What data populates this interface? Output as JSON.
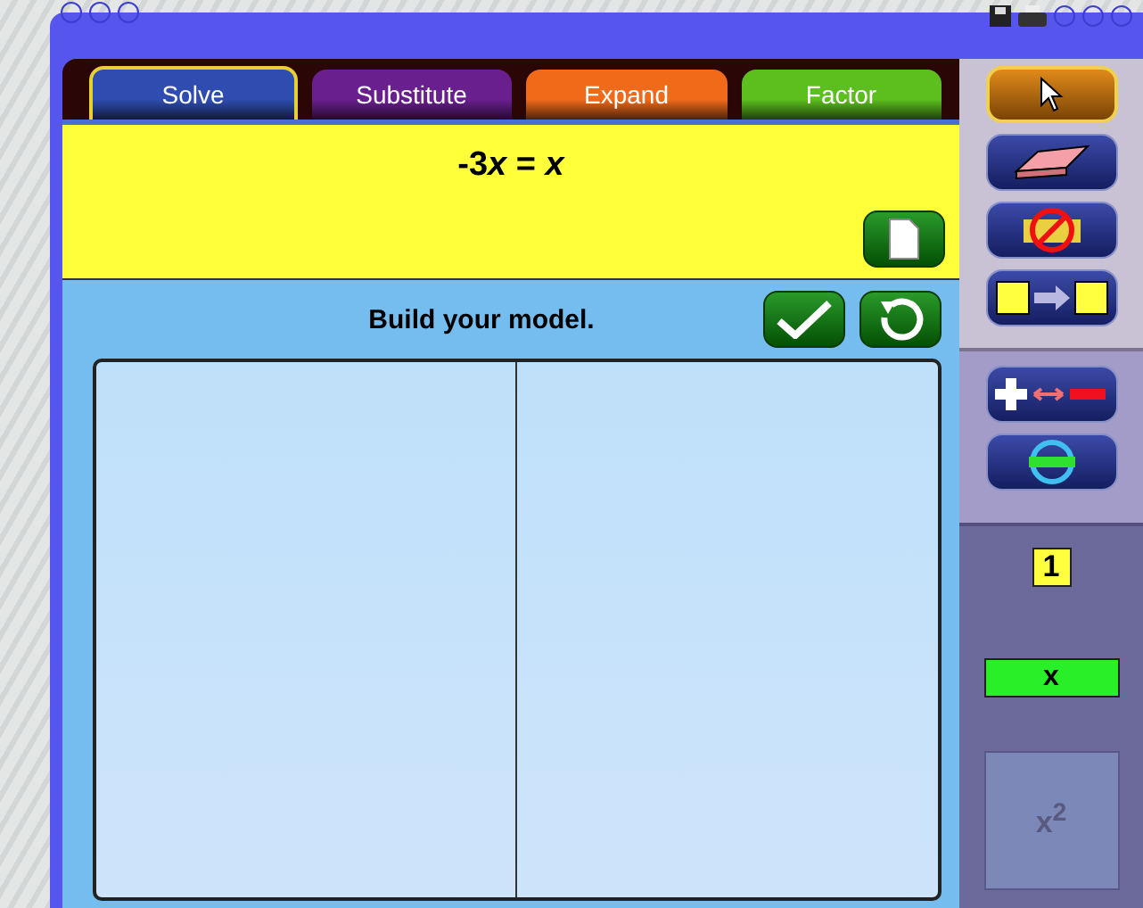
{
  "tabs": [
    {
      "label": "Solve",
      "color": "#2f4db0",
      "selected": true
    },
    {
      "label": "Substitute",
      "color": "#6a1f8f",
      "selected": false
    },
    {
      "label": "Expand",
      "color": "#f06a1a",
      "selected": false
    },
    {
      "label": "Factor",
      "color": "#5cbf1e",
      "selected": false
    }
  ],
  "equation": {
    "coefficient": "-3",
    "variable": "x",
    "relation": "=",
    "rhs": "x"
  },
  "instruction": "Build your model.",
  "tools": [
    {
      "kind": "pointer",
      "selected": true
    },
    {
      "kind": "eraser",
      "selected": false
    },
    {
      "kind": "no-flip",
      "selected": false
    },
    {
      "kind": "duplicate",
      "selected": false
    }
  ],
  "operations": [
    {
      "kind": "sign-swap"
    },
    {
      "kind": "rotate"
    }
  ],
  "tiles": [
    {
      "kind": "unit",
      "label": "1",
      "disabled": false
    },
    {
      "kind": "bar",
      "label": "x",
      "disabled": false
    },
    {
      "kind": "square",
      "label": "x$^{2}$",
      "disabled": true
    }
  ]
}
